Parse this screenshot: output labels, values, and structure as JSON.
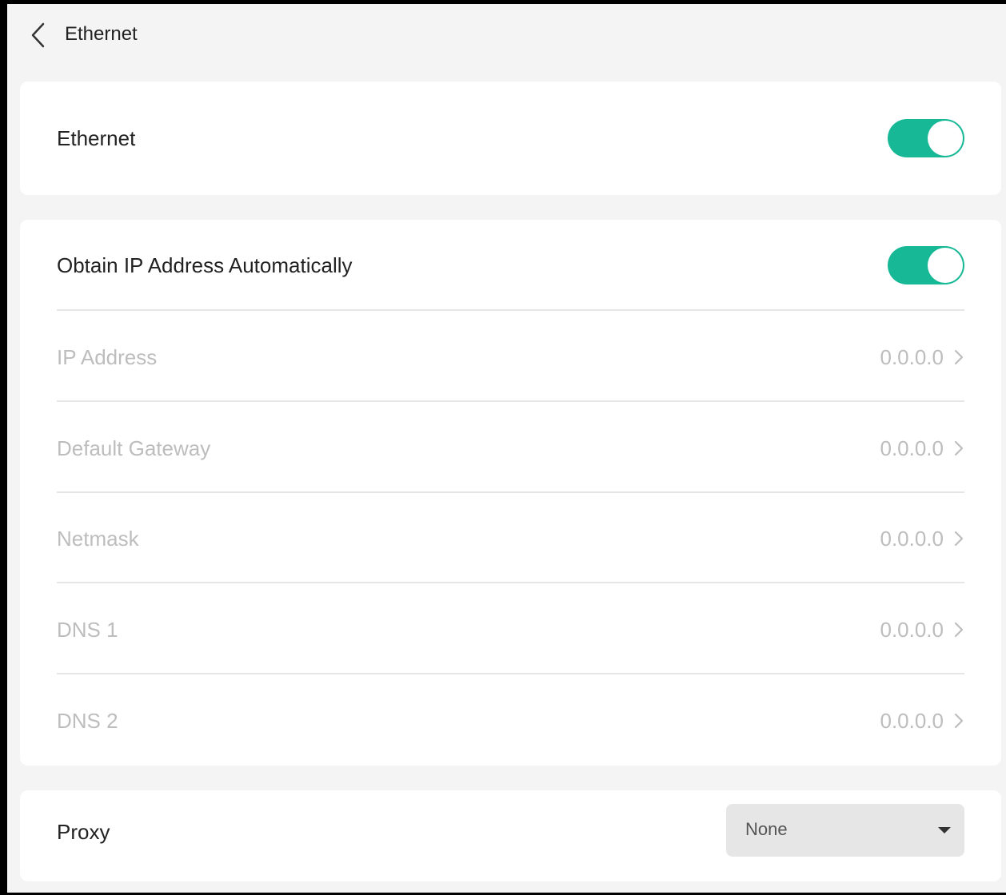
{
  "header": {
    "title": "Ethernet",
    "back_icon": "chevron-left-icon"
  },
  "ethernet": {
    "label": "Ethernet",
    "enabled": true
  },
  "ip_settings": {
    "auto_label": "Obtain IP Address Automatically",
    "auto_enabled": true,
    "rows": [
      {
        "label": "IP Address",
        "value": "0.0.0.0"
      },
      {
        "label": "Default Gateway",
        "value": "0.0.0.0"
      },
      {
        "label": "Netmask",
        "value": "0.0.0.0"
      },
      {
        "label": "DNS 1",
        "value": "0.0.0.0"
      },
      {
        "label": "DNS 2",
        "value": "0.0.0.0"
      }
    ]
  },
  "proxy": {
    "label": "Proxy",
    "selected": "None"
  },
  "colors": {
    "accent": "#16b895",
    "background": "#f4f4f4",
    "card": "#ffffff",
    "disabled_text": "#bdbdbd",
    "text": "#222222"
  }
}
